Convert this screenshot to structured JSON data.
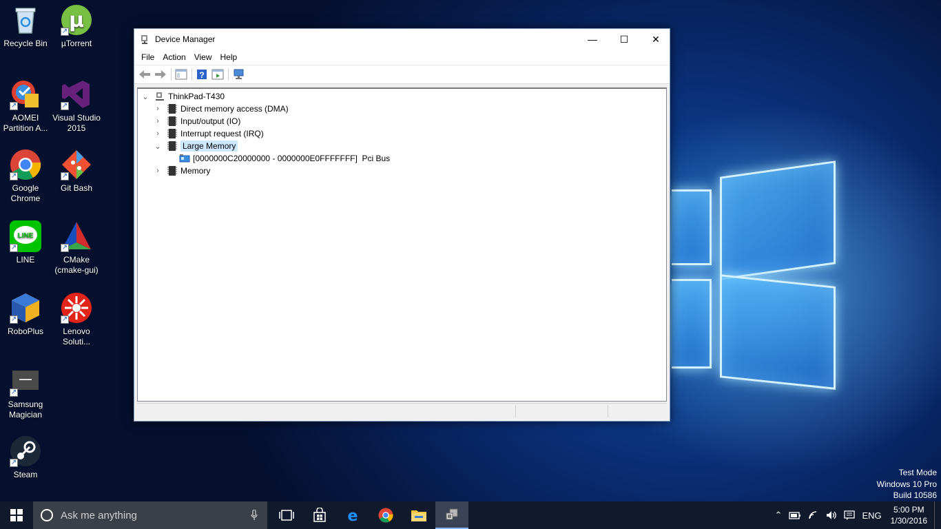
{
  "desktop": {
    "icons": [
      {
        "label_1": "Recycle Bin",
        "label_2": ""
      },
      {
        "label_1": "µTorrent",
        "label_2": ""
      },
      {
        "label_1": "AOMEI",
        "label_2": "Partition A..."
      },
      {
        "label_1": "Visual Studio",
        "label_2": "2015"
      },
      {
        "label_1": "Google",
        "label_2": "Chrome"
      },
      {
        "label_1": "Git Bash",
        "label_2": ""
      },
      {
        "label_1": "LINE",
        "label_2": ""
      },
      {
        "label_1": "CMake",
        "label_2": "(cmake-gui)"
      },
      {
        "label_1": "RoboPlus",
        "label_2": ""
      },
      {
        "label_1": "Lenovo",
        "label_2": "Soluti..."
      },
      {
        "label_1": "Samsung",
        "label_2": "Magician"
      },
      {
        "label_1": "Steam",
        "label_2": ""
      }
    ],
    "watermark": {
      "line1": "Test Mode",
      "line2": "Windows 10 Pro",
      "line3": "Build 10586"
    }
  },
  "window": {
    "title": "Device Manager",
    "controls": {
      "minimize": "—",
      "maximize": "☐",
      "close": "✕"
    },
    "menu": [
      "File",
      "Action",
      "View",
      "Help"
    ],
    "tree": {
      "root": "ThinkPad-T430",
      "items": [
        {
          "label": "Direct memory access (DMA)"
        },
        {
          "label": "Input/output (IO)"
        },
        {
          "label": "Interrupt request (IRQ)"
        },
        {
          "label": "Large Memory"
        },
        {
          "label": "[0000000C20000000 - 0000000E0FFFFFFF]  Pci Bus"
        },
        {
          "label": "Memory"
        }
      ]
    }
  },
  "taskbar": {
    "search_placeholder": "Ask me anything",
    "language": "ENG",
    "time": "5:00 PM",
    "date": "1/30/2016"
  },
  "colors": {
    "selection": "#cce8ff",
    "taskbar": "#101a2c",
    "accent": "#0078d7"
  }
}
